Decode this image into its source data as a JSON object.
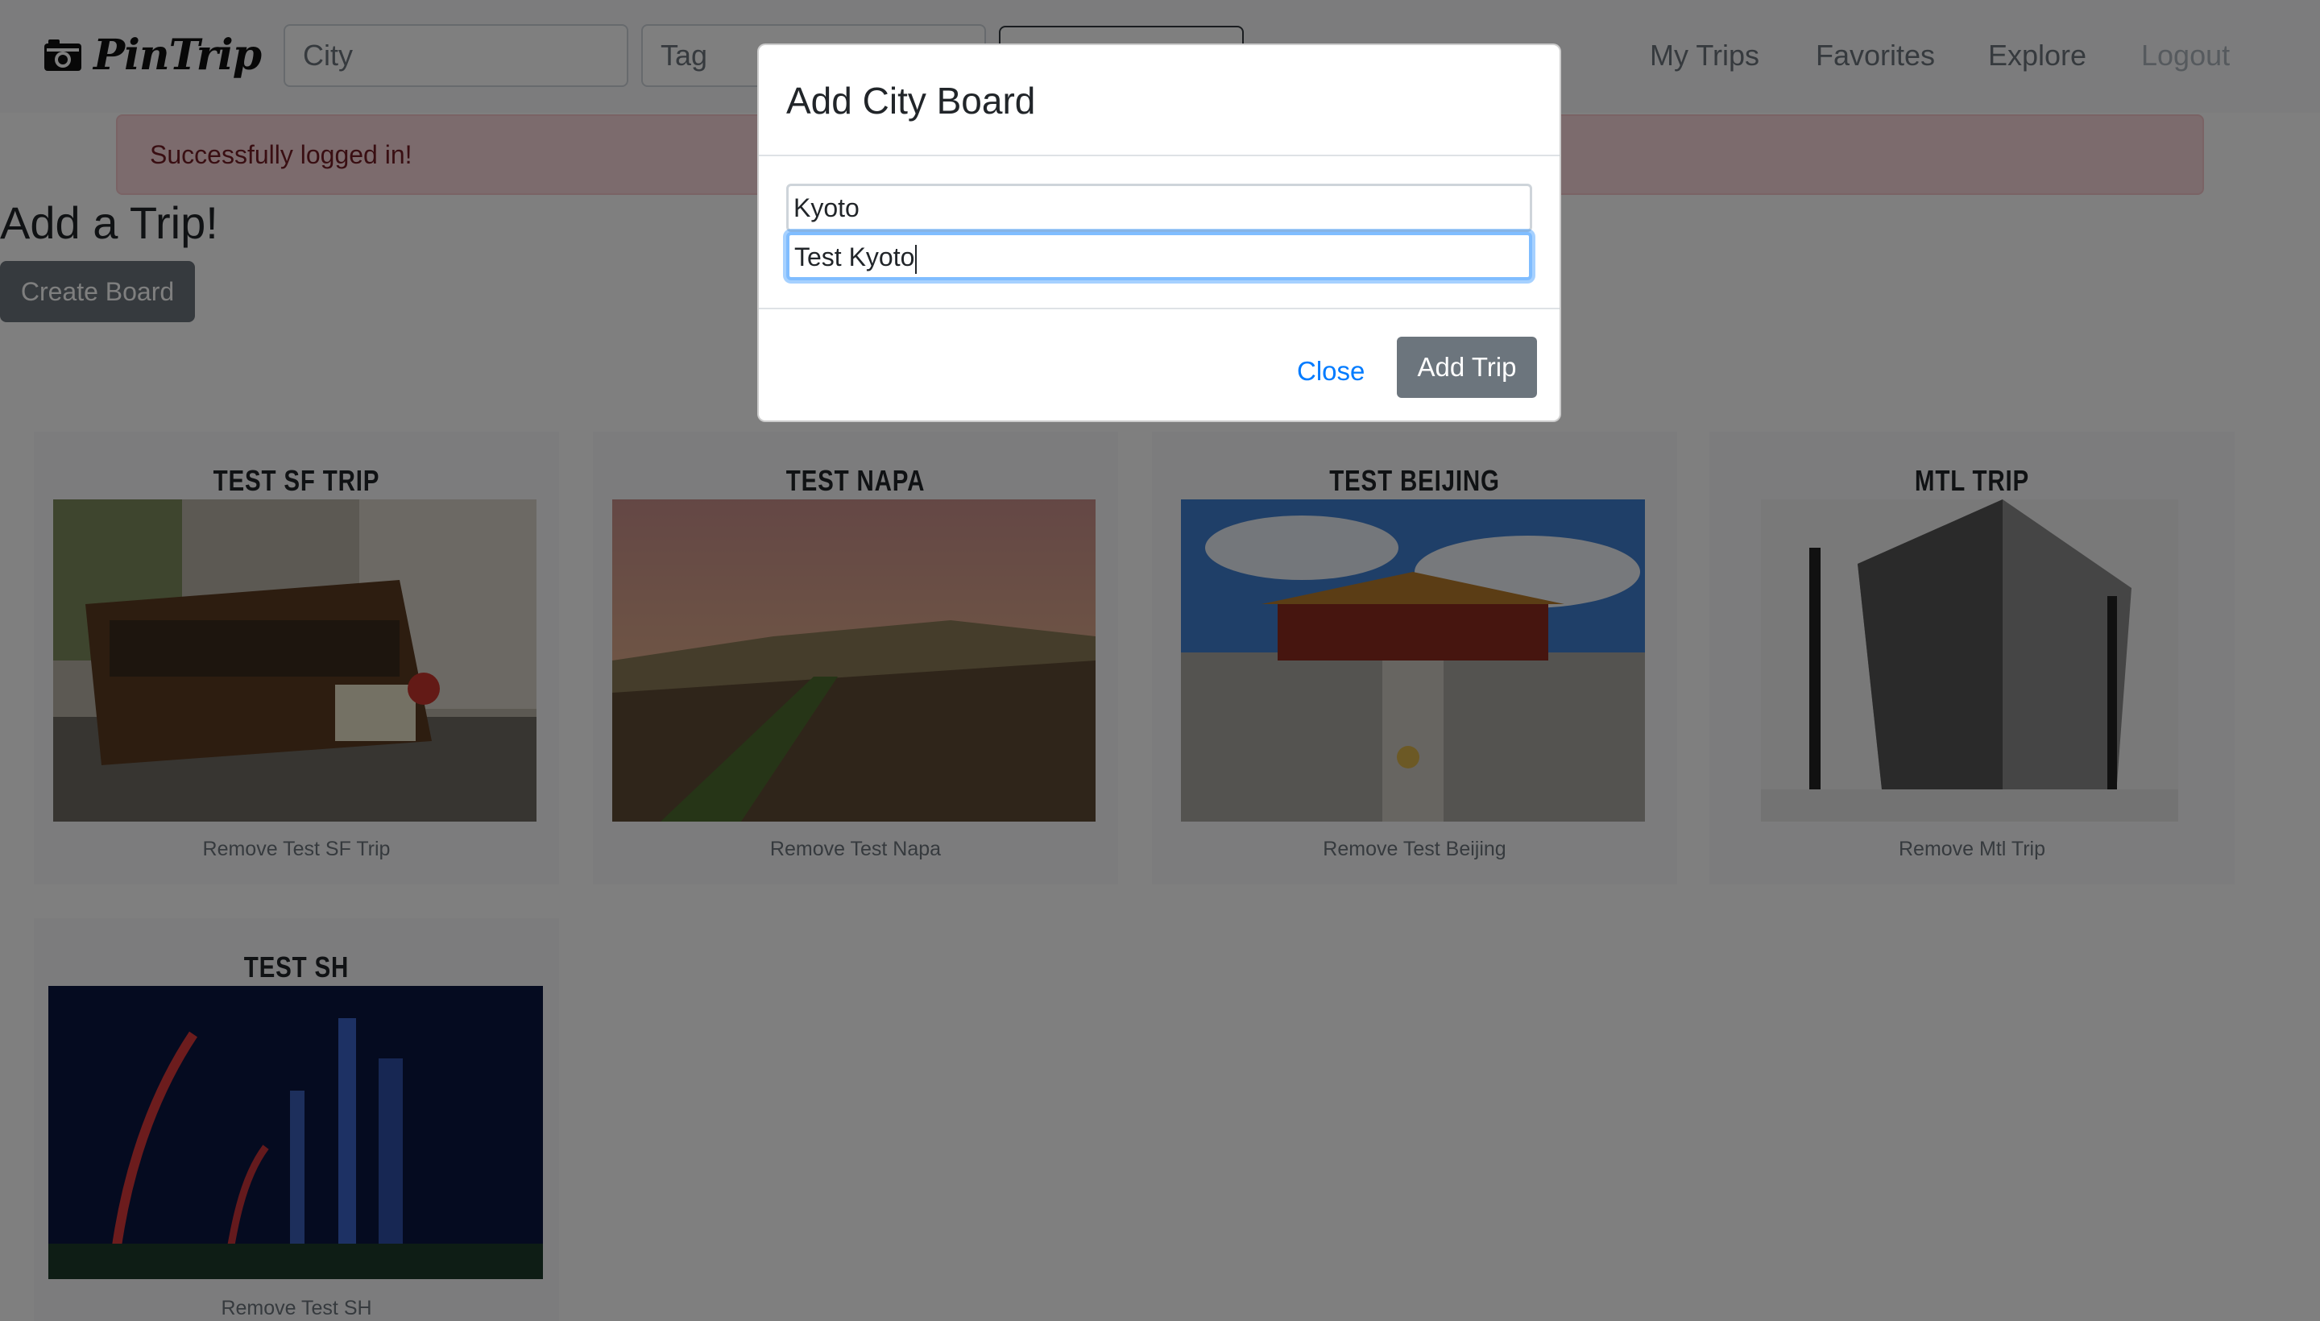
{
  "navbar": {
    "brand": "PinTrip",
    "brand_icon": "camera-icon",
    "city_placeholder": "City",
    "tag_placeholder": "Tag",
    "links": [
      "My Trips",
      "Favorites",
      "Explore",
      "Logout"
    ]
  },
  "alert": {
    "message": "Successfully logged in!"
  },
  "page": {
    "heading": "Add a Trip!",
    "create_button": "Create Board"
  },
  "boards": [
    {
      "title": "TEST SF TRIP",
      "remove": "Remove Test SF Trip"
    },
    {
      "title": "TEST NAPA",
      "remove": "Remove Test Napa"
    },
    {
      "title": "TEST BEIJING",
      "remove": "Remove Test Beijing"
    },
    {
      "title": "MTL TRIP",
      "remove": "Remove Mtl Trip"
    },
    {
      "title": "TEST SH",
      "remove": "Remove Test SH"
    }
  ],
  "modal": {
    "title": "Add City Board",
    "city_value": "Kyoto",
    "name_value": "Test Kyoto",
    "close_label": "Close",
    "submit_label": "Add Trip"
  },
  "colors": {
    "alert_bg": "#f8d7da",
    "alert_text": "#721c24",
    "secondary_button": "#6c757d",
    "link_blue": "#007bff",
    "focus_ring": "#80bdff"
  }
}
